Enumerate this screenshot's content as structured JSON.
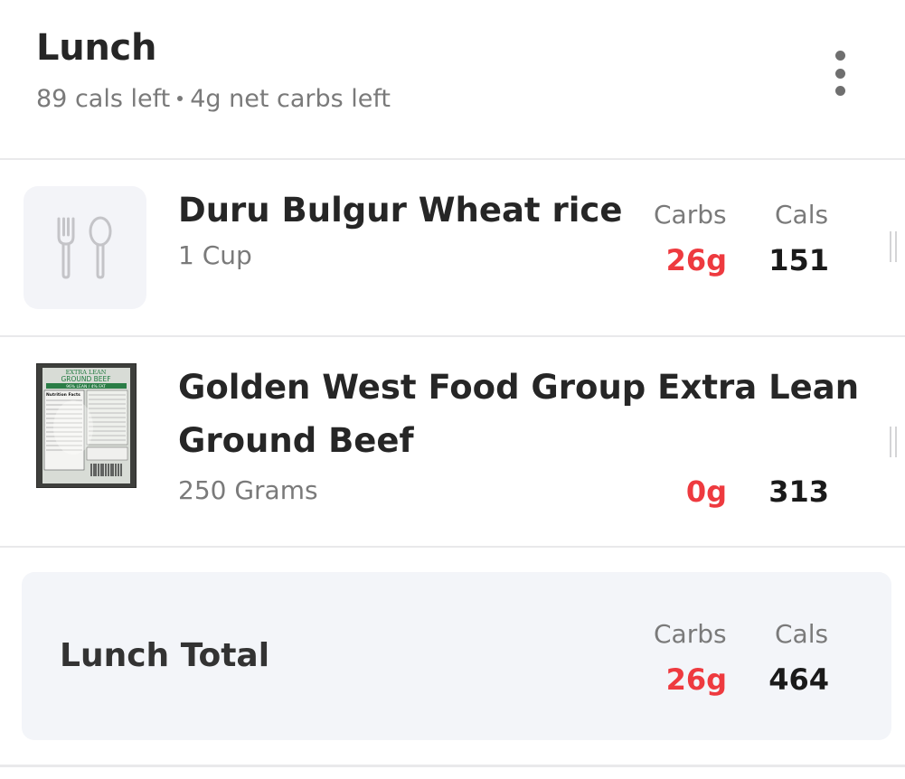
{
  "meal": {
    "title": "Lunch",
    "cals_left": "89 cals left",
    "carbs_left": "4g net carbs left"
  },
  "labels": {
    "carbs": "Carbs",
    "cals": "Cals"
  },
  "items": [
    {
      "name": "Duru Bulgur Wheat rice",
      "portion": "1 Cup",
      "carbs": "26g",
      "cals": "151",
      "thumb_icon": "fork-spoon-icon"
    },
    {
      "name_line1": "Golden West Food Group Extra Lean",
      "name_line2": "Ground Beef",
      "portion": "250 Grams",
      "carbs": "0g",
      "cals": "313",
      "package_text": {
        "brand": "EXTRA LEAN",
        "product": "GROUND BEEF",
        "ratio": "96% LEAN / 4% FAT",
        "facts": "Nutrition Facts"
      }
    }
  ],
  "total": {
    "label": "Lunch Total",
    "carbs": "26g",
    "cals": "464"
  },
  "colors": {
    "carbs": "#ee3a3f",
    "text": "#262626",
    "muted": "#7a7a7a",
    "panel": "#f3f5f9"
  }
}
